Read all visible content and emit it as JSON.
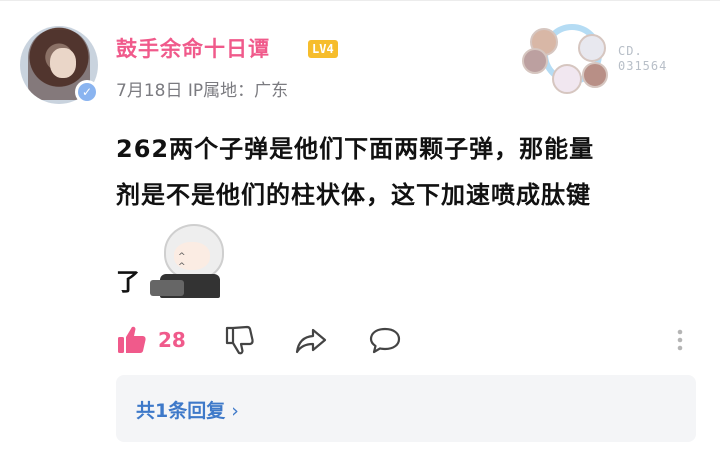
{
  "comment": {
    "username": "鼓手余命十日谭",
    "level": "LV4",
    "date": "7月18日",
    "ip_location": "IP属地：广东",
    "badge_code": "CD.\n031564",
    "content_lines": [
      "262两个子弹是他们下面两颗子弹，那能量",
      "剂是不是他们的柱状体，这下加速喷成肽键"
    ],
    "content_tail": "了",
    "like_count": "28",
    "reply_summary": "共1条回复",
    "reply_chevron": "›"
  },
  "colors": {
    "username": "#f05a8b",
    "level_badge": "#f6bd2c",
    "like": "#f05a8b",
    "reply_link": "#3e79c9",
    "reply_box_bg": "#f4f5f7"
  },
  "icons": [
    "verified-icon",
    "thumb-up-icon",
    "thumb-down-icon",
    "share-icon",
    "comment-icon",
    "more-vertical-icon",
    "chevron-right-icon"
  ]
}
